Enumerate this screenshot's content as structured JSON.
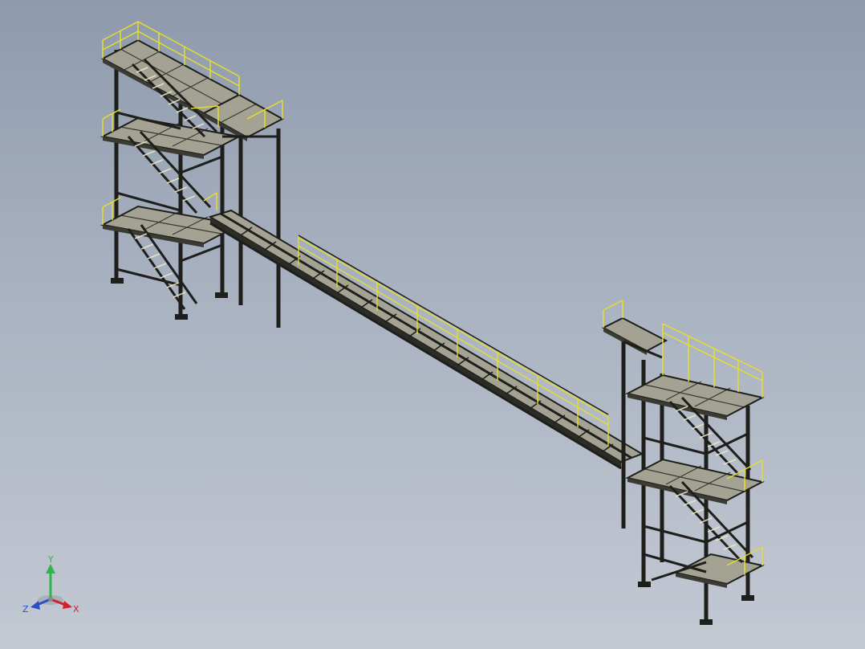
{
  "view": {
    "background_top": "#8e9aad",
    "background_bottom": "#c3c9d3",
    "steel_color": "#1e1e1a",
    "deck_color": "#a3a293",
    "railing_color": "#e6dd2c",
    "stair_color": "#ece9c8"
  },
  "triad": {
    "x_label": "X",
    "y_label": "Y",
    "z_label": "Z",
    "x_color": "#d0202a",
    "y_color": "#2fb54a",
    "z_color": "#2c4fc0"
  }
}
